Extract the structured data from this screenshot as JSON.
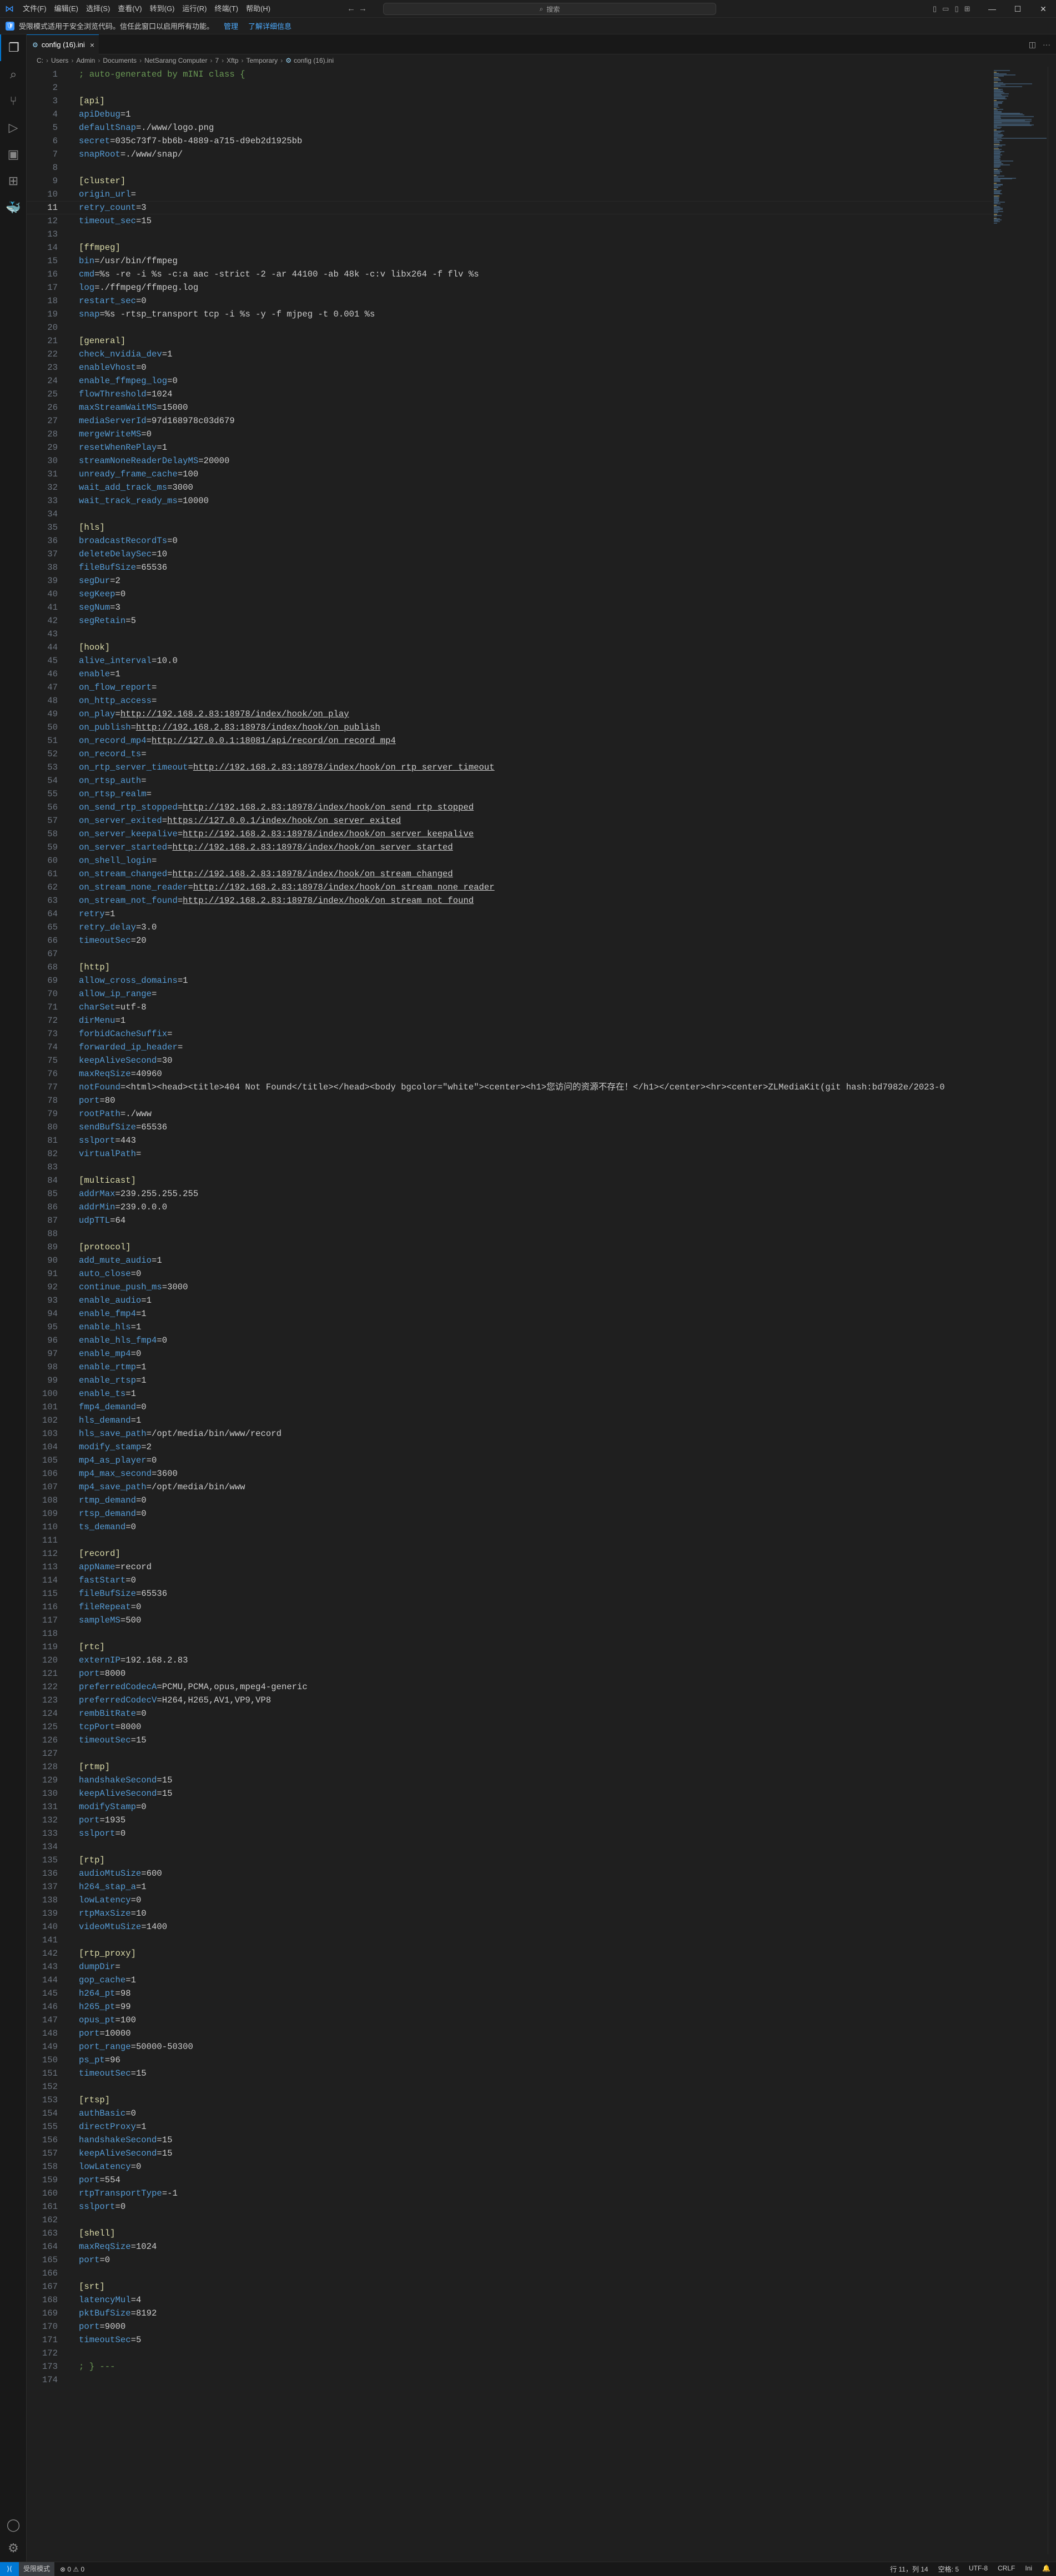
{
  "window": {
    "menu": [
      "文件(F)",
      "编辑(E)",
      "选择(S)",
      "查看(V)",
      "转到(G)",
      "运行(R)",
      "终端(T)",
      "帮助(H)"
    ],
    "search_placeholder": "搜索"
  },
  "banner": {
    "message": "受限模式适用于安全浏览代码。信任此窗口以启用所有功能。",
    "manage": "管理",
    "learn_more": "了解详细信息"
  },
  "tab": {
    "label": "config (16).ini",
    "icon": "gear-icon"
  },
  "breadcrumb": [
    "C:",
    "Users",
    "Admin",
    "Documents",
    "NetSarang Computer",
    "7",
    "Xftp",
    "Temporary",
    "config (16).ini"
  ],
  "editor": {
    "cursor_line": 11,
    "lines": [
      "; auto-generated by mINI class {",
      "",
      "[api]",
      "apiDebug=1",
      "defaultSnap=./www/logo.png",
      "secret=035c73f7-bb6b-4889-a715-d9eb2d1925bb",
      "snapRoot=./www/snap/",
      "",
      "[cluster]",
      "origin_url=",
      "retry_count=3",
      "timeout_sec=15",
      "",
      "[ffmpeg]",
      "bin=/usr/bin/ffmpeg",
      "cmd=%s -re -i %s -c:a aac -strict -2 -ar 44100 -ab 48k -c:v libx264 -f flv %s",
      "log=./ffmpeg/ffmpeg.log",
      "restart_sec=0",
      "snap=%s -rtsp_transport tcp -i %s -y -f mjpeg -t 0.001 %s",
      "",
      "[general]",
      "check_nvidia_dev=1",
      "enableVhost=0",
      "enable_ffmpeg_log=0",
      "flowThreshold=1024",
      "maxStreamWaitMS=15000",
      "mediaServerId=97d168978c03d679",
      "mergeWriteMS=0",
      "resetWhenRePlay=1",
      "streamNoneReaderDelayMS=20000",
      "unready_frame_cache=100",
      "wait_add_track_ms=3000",
      "wait_track_ready_ms=10000",
      "",
      "[hls]",
      "broadcastRecordTs=0",
      "deleteDelaySec=10",
      "fileBufSize=65536",
      "segDur=2",
      "segKeep=0",
      "segNum=3",
      "segRetain=5",
      "",
      "[hook]",
      "alive_interval=10.0",
      "enable=1",
      "on_flow_report=",
      "on_http_access=",
      "on_play=http://192.168.2.83:18978/index/hook/on_play",
      "on_publish=http://192.168.2.83:18978/index/hook/on_publish",
      "on_record_mp4=http://127.0.0.1:18081/api/record/on_record_mp4",
      "on_record_ts=",
      "on_rtp_server_timeout=http://192.168.2.83:18978/index/hook/on_rtp_server_timeout",
      "on_rtsp_auth=",
      "on_rtsp_realm=",
      "on_send_rtp_stopped=http://192.168.2.83:18978/index/hook/on_send_rtp_stopped",
      "on_server_exited=https://127.0.0.1/index/hook/on_server_exited",
      "on_server_keepalive=http://192.168.2.83:18978/index/hook/on_server_keepalive",
      "on_server_started=http://192.168.2.83:18978/index/hook/on_server_started",
      "on_shell_login=",
      "on_stream_changed=http://192.168.2.83:18978/index/hook/on_stream_changed",
      "on_stream_none_reader=http://192.168.2.83:18978/index/hook/on_stream_none_reader",
      "on_stream_not_found=http://192.168.2.83:18978/index/hook/on_stream_not_found",
      "retry=1",
      "retry_delay=3.0",
      "timeoutSec=20",
      "",
      "[http]",
      "allow_cross_domains=1",
      "allow_ip_range=",
      "charSet=utf-8",
      "dirMenu=1",
      "forbidCacheSuffix=",
      "forwarded_ip_header=",
      "keepAliveSecond=30",
      "maxReqSize=40960",
      "notFound=<html><head><title>404 Not Found</title></head><body bgcolor=\"white\"><center><h1>您访问的资源不存在！</h1></center><hr><center>ZLMediaKit(git hash:bd7982e/2023-0",
      "port=80",
      "rootPath=./www",
      "sendBufSize=65536",
      "sslport=443",
      "virtualPath=",
      "",
      "[multicast]",
      "addrMax=239.255.255.255",
      "addrMin=239.0.0.0",
      "udpTTL=64",
      "",
      "[protocol]",
      "add_mute_audio=1",
      "auto_close=0",
      "continue_push_ms=3000",
      "enable_audio=1",
      "enable_fmp4=1",
      "enable_hls=1",
      "enable_hls_fmp4=0",
      "enable_mp4=0",
      "enable_rtmp=1",
      "enable_rtsp=1",
      "enable_ts=1",
      "fmp4_demand=0",
      "hls_demand=1",
      "hls_save_path=/opt/media/bin/www/record",
      "modify_stamp=2",
      "mp4_as_player=0",
      "mp4_max_second=3600",
      "mp4_save_path=/opt/media/bin/www",
      "rtmp_demand=0",
      "rtsp_demand=0",
      "ts_demand=0",
      "",
      "[record]",
      "appName=record",
      "fastStart=0",
      "fileBufSize=65536",
      "fileRepeat=0",
      "sampleMS=500",
      "",
      "[rtc]",
      "externIP=192.168.2.83",
      "port=8000",
      "preferredCodecA=PCMU,PCMA,opus,mpeg4-generic",
      "preferredCodecV=H264,H265,AV1,VP9,VP8",
      "rembBitRate=0",
      "tcpPort=8000",
      "timeoutSec=15",
      "",
      "[rtmp]",
      "handshakeSecond=15",
      "keepAliveSecond=15",
      "modifyStamp=0",
      "port=1935",
      "sslport=0",
      "",
      "[rtp]",
      "audioMtuSize=600",
      "h264_stap_a=1",
      "lowLatency=0",
      "rtpMaxSize=10",
      "videoMtuSize=1400",
      "",
      "[rtp_proxy]",
      "dumpDir=",
      "gop_cache=1",
      "h264_pt=98",
      "h265_pt=99",
      "opus_pt=100",
      "port=10000",
      "port_range=50000-50300",
      "ps_pt=96",
      "timeoutSec=15",
      "",
      "[rtsp]",
      "authBasic=0",
      "directProxy=1",
      "handshakeSecond=15",
      "keepAliveSecond=15",
      "lowLatency=0",
      "port=554",
      "rtpTransportType=-1",
      "sslport=0",
      "",
      "[shell]",
      "maxReqSize=1024",
      "port=0",
      "",
      "[srt]",
      "latencyMul=4",
      "pktBufSize=8192",
      "port=9000",
      "timeoutSec=5",
      "",
      "; } ---",
      ""
    ]
  },
  "statusbar": {
    "restricted": "受限模式",
    "problems": "⊗ 0  ⚠ 0",
    "position": "行 11，列 14",
    "spaces": "空格: 5",
    "encoding": "UTF-8",
    "eol": "CRLF",
    "language": "Ini"
  }
}
